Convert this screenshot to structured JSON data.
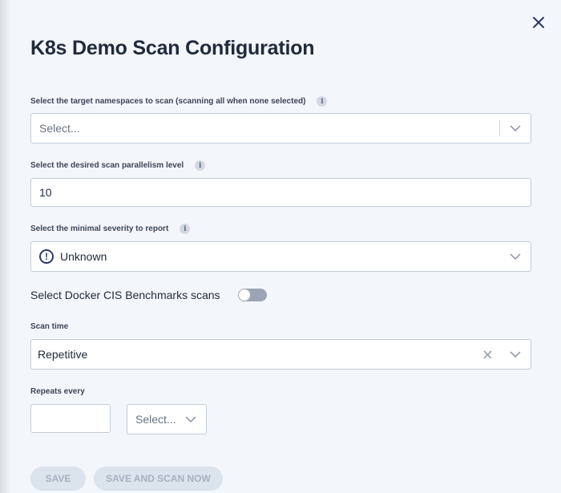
{
  "dialog": {
    "title": "K8s Demo Scan Configuration"
  },
  "namespaces": {
    "label": "Select the target namespaces to scan (scanning all when none selected)",
    "placeholder": "Select..."
  },
  "parallelism": {
    "label": "Select the desired scan parallelism level",
    "value": "10"
  },
  "severity": {
    "label": "Select the minimal severity to report",
    "value": "Unknown"
  },
  "docker_cis": {
    "label": "Select Docker CIS Benchmarks scans",
    "enabled": false
  },
  "scan_time": {
    "label": "Scan time",
    "value": "Repetitive"
  },
  "repeats": {
    "label": "Repeats every",
    "amount": "",
    "unit_placeholder": "Select..."
  },
  "actions": {
    "save_label": "SAVE",
    "save_and_scan_label": "SAVE AND SCAN NOW"
  },
  "colors": {
    "background": "#f3f6fb",
    "accent": "#2b3a67",
    "disabled_button": "#dbe3ec"
  }
}
